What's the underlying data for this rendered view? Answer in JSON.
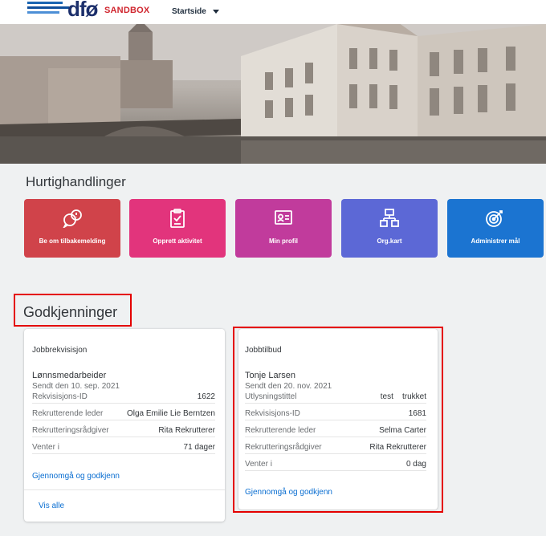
{
  "header": {
    "logo_text": "dfø",
    "env_badge": "SANDBOX",
    "nav_label": "Startside"
  },
  "quick": {
    "title": "Hurtighandlinger",
    "tiles": [
      {
        "label": "Be om tilbakemelding",
        "icon": "feedback-bubbles-icon",
        "color": "#d0434a"
      },
      {
        "label": "Opprett aktivitet",
        "icon": "clipboard-check-icon",
        "color": "#e2347c"
      },
      {
        "label": "Min profil",
        "icon": "id-card-icon",
        "color": "#c13b9c"
      },
      {
        "label": "Org.kart",
        "icon": "org-chart-icon",
        "color": "#5c68d6"
      },
      {
        "label": "Administrer mål",
        "icon": "target-icon",
        "color": "#1b74d1"
      }
    ]
  },
  "approvals": {
    "title": "Godkjenninger",
    "cards": [
      {
        "title": "Jobbrekvisisjon",
        "name": "Lønnsmedarbeider",
        "sent": "Sendt den 10. sep. 2021",
        "rows": [
          {
            "label": "Rekvisisjons-ID",
            "value": "1622"
          },
          {
            "label": "Rekrutterende leder",
            "value": "Olga Emilie Lie Berntzen"
          },
          {
            "label": "Rekrutteringsrådgiver",
            "value": "Rita Rekrutterer"
          },
          {
            "label": "Venter i",
            "value": "71 dager"
          }
        ],
        "action": "Gjennomgå og godkjenn",
        "footer": "Vis alle"
      },
      {
        "title": "Jobbtilbud",
        "name": "Tonje Larsen",
        "sent": "Sendt den 20. nov. 2021",
        "rows": [
          {
            "label": "Utlysningstittel",
            "value": "test    trukket"
          },
          {
            "label": "Rekvisisjons-ID",
            "value": "1681"
          },
          {
            "label": "Rekrutterende leder",
            "value": "Selma Carter"
          },
          {
            "label": "Rekrutteringsrådgiver",
            "value": "Rita Rekrutterer"
          },
          {
            "label": "Venter i",
            "value": "0 dag"
          }
        ],
        "action": "Gjennomgå og godkjenn"
      }
    ]
  }
}
